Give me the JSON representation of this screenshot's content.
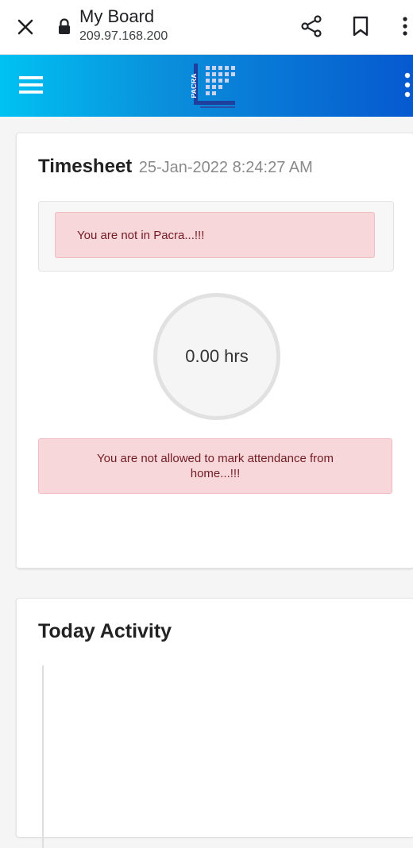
{
  "browser": {
    "title": "My Board",
    "url": "209.97.168.200",
    "icons": [
      "close-icon",
      "lock-icon",
      "share-icon",
      "bookmark-icon",
      "more-vert-icon"
    ]
  },
  "appbar": {
    "logo_text": "PACRA",
    "colors": {
      "gradient_start": "#00c2f2",
      "gradient_end": "#0659cf"
    }
  },
  "timesheet": {
    "title": "Timesheet",
    "datetime": "25-Jan-2022 8:24:27 AM",
    "location_alert": "You are not in Pacra...!!!",
    "hours": "0.00 hrs",
    "attendance_alert": "You are not allowed to mark attendance from home...!!!"
  },
  "activity": {
    "title": "Today Activity"
  }
}
